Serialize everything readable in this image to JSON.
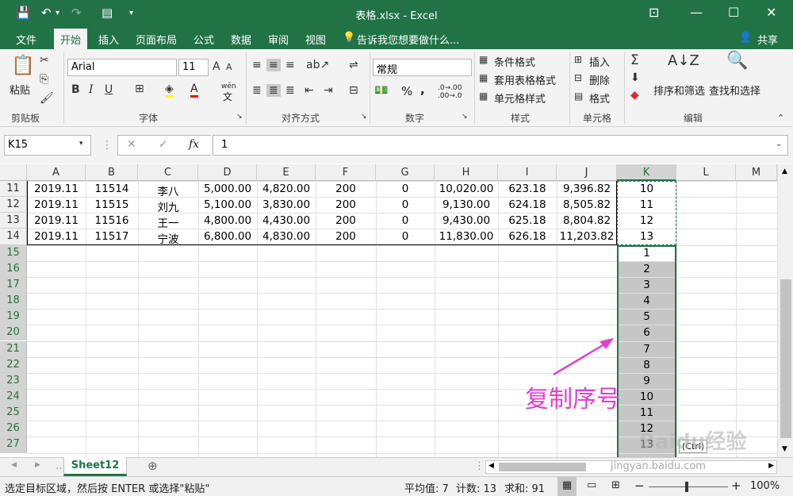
{
  "window": {
    "title": "表格.xlsx - Excel"
  },
  "menu": {
    "items": [
      "文件",
      "开始",
      "插入",
      "页面布局",
      "公式",
      "数据",
      "审阅",
      "视图"
    ],
    "active_index": 1,
    "tell_me": "告诉我您想要做什么...",
    "share": "共享"
  },
  "ribbon": {
    "clipboard": {
      "paste": "粘贴",
      "label": "剪贴板"
    },
    "font": {
      "name": "Arial",
      "size": "11",
      "label": "字体",
      "wen": "wén",
      "wen2": "文"
    },
    "alignment": {
      "label": "对齐方式"
    },
    "number": {
      "format": "常规",
      "label": "数字",
      "percent": "%",
      "comma": ",",
      "inc": ".0→.00",
      "dec": ".00→.0"
    },
    "styles": {
      "conditional": "条件格式",
      "table": "套用表格格式",
      "cell": "单元格样式",
      "label": "样式"
    },
    "cells": {
      "insert": "插入",
      "delete": "删除",
      "format": "格式",
      "label": "单元格"
    },
    "editing": {
      "sort": "排序和筛选",
      "find": "查找和选择",
      "label": "编辑"
    }
  },
  "formula_bar": {
    "name_box": "K15",
    "value": "1",
    "fx": "fx"
  },
  "grid": {
    "columns": [
      "A",
      "B",
      "C",
      "D",
      "E",
      "F",
      "G",
      "H",
      "I",
      "J",
      "K",
      "L",
      "M"
    ],
    "data_rows": [
      {
        "row": "11",
        "cells": [
          "2019.11",
          "11514",
          "李八",
          "5,000.00",
          "4,820.00",
          "200",
          "0",
          "10,020.00",
          "623.18",
          "9,396.82",
          "10"
        ]
      },
      {
        "row": "12",
        "cells": [
          "2019.11",
          "11515",
          "刘九",
          "5,100.00",
          "3,830.00",
          "200",
          "0",
          "9,130.00",
          "624.18",
          "8,505.82",
          "11"
        ]
      },
      {
        "row": "13",
        "cells": [
          "2019.11",
          "11516",
          "王一",
          "4,800.00",
          "4,430.00",
          "200",
          "0",
          "9,430.00",
          "625.18",
          "8,804.82",
          "12"
        ]
      },
      {
        "row": "14",
        "cells": [
          "2019.11",
          "11517",
          "宁波",
          "6,800.00",
          "4,830.00",
          "200",
          "0",
          "11,830.00",
          "626.18",
          "11,203.82",
          "13"
        ]
      }
    ],
    "empty_rows": [
      "15",
      "16",
      "17",
      "18",
      "19",
      "20",
      "21",
      "22",
      "23",
      "24",
      "25",
      "26",
      "27"
    ],
    "pasted_k": [
      "1",
      "2",
      "3",
      "4",
      "5",
      "6",
      "7",
      "8",
      "9",
      "10",
      "11",
      "12",
      "13"
    ],
    "paste_options": "(Ctrl)"
  },
  "annotation": {
    "text": "复制序号",
    "color": "#e040d0"
  },
  "sheet_tabs": {
    "active": "Sheet12"
  },
  "status": {
    "message": "选定目标区域，然后按 ENTER 或选择\"粘贴\"",
    "average": "平均值: 7",
    "count": "计数: 13",
    "sum": "求和: 91",
    "zoom": "100%"
  },
  "watermark": {
    "text": "Baidu经验",
    "sub": "jingyan.baidu.com"
  },
  "colors": {
    "excel_green": "#217346",
    "selection": "#c6c6c6",
    "accent_pink": "#e040d0"
  }
}
